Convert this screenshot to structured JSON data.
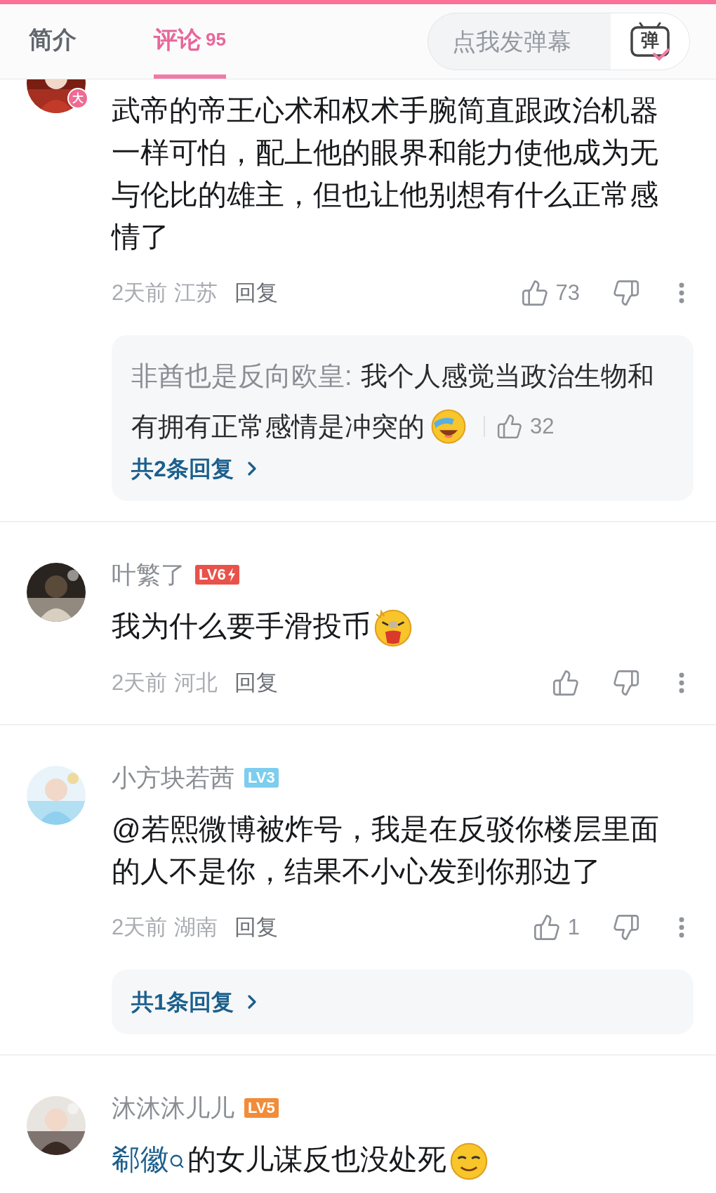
{
  "tabs": [
    {
      "label": "简介",
      "selected": false
    },
    {
      "label": "评论",
      "count": "95",
      "selected": true
    }
  ],
  "danmaku": {
    "placeholder": "点我发弹幕",
    "button": "弹"
  },
  "comments": [
    {
      "avatar_badge": "大",
      "text": "武帝的帝王心术和权术手腕简直跟政治机器一样可怕，配上他的眼界和能力使他成为无与伦比的雄主，但也让他别想有什么正常感情了",
      "time": "2天前",
      "location": "江苏",
      "reply": "回复",
      "likes": "73",
      "thread": {
        "replies": [
          {
            "user": "非酋也是反向欧皇:",
            "lines": [
              "我个人感觉当政治生物和",
              "有拥有正常感情是冲突的"
            ],
            "emoji": {
              "kind": "laughing"
            },
            "likes": "32"
          }
        ],
        "more": "共2条回复"
      }
    },
    {
      "user": "叶繁了",
      "level": {
        "label": "LV6",
        "color": "#e8524a",
        "spark": true
      },
      "text": "我为什么要手滑投币",
      "emoji": {
        "kind": "shouting"
      },
      "time": "2天前",
      "location": "河北",
      "reply": "回复"
    },
    {
      "user": "小方块若茜",
      "level": {
        "label": "LV3",
        "color": "#7ccdee",
        "spark": false
      },
      "text": "@若熙微博被炸号，我是在反驳你楼层里面的人不是你，结果不小心发到你那边了",
      "time": "2天前",
      "location": "湖南",
      "reply": "回复",
      "likes": "1",
      "thread": {
        "more": "共1条回复"
      }
    },
    {
      "user": "沐沐沐儿儿",
      "level": {
        "label": "LV5",
        "color": "#f28c38",
        "spark": false
      },
      "mention": "郗徽",
      "text": "的女儿谋反也没处死",
      "emoji": {
        "kind": "grinning"
      }
    }
  ]
}
